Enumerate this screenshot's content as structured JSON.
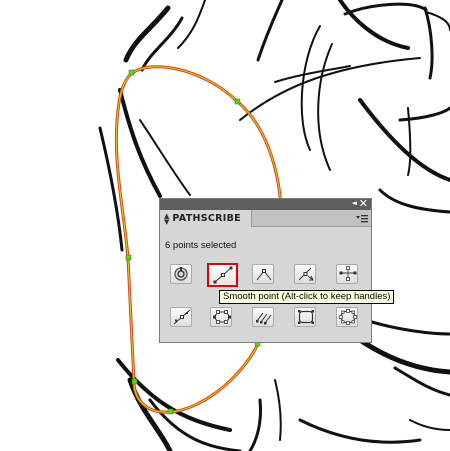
{
  "panel": {
    "title": "PATHSCRIBE",
    "collapse_glyph": "◂◂",
    "close_glyph": "✕",
    "status": "6 points selected",
    "menu_icon": "panel-menu-icon"
  },
  "tools": [
    {
      "id": "convert",
      "icon": "convert-icon"
    },
    {
      "id": "smooth",
      "icon": "smooth-point-icon",
      "active": true
    },
    {
      "id": "corner",
      "icon": "corner-point-icon"
    },
    {
      "id": "retract",
      "icon": "retract-handles-icon"
    },
    {
      "id": "align",
      "icon": "align-points-icon"
    },
    {
      "id": "add-point",
      "icon": "add-point-icon"
    },
    {
      "id": "distribute",
      "icon": "distribute-icon"
    },
    {
      "id": "extend",
      "icon": "extend-handles-icon"
    },
    {
      "id": "rect-shape",
      "icon": "rectangle-shape-icon"
    },
    {
      "id": "ellipse-shape",
      "icon": "ellipse-shape-icon"
    }
  ],
  "tooltip": "Smooth point (Alt-click to keep handles)",
  "colors": {
    "path_outer": "#c84a1a",
    "path_inner": "#e8d020",
    "anchor": "#5fd020",
    "active_outline": "#e00000",
    "panel_bg": "#d6d6d6",
    "titlebar": "#5e5e5e"
  }
}
